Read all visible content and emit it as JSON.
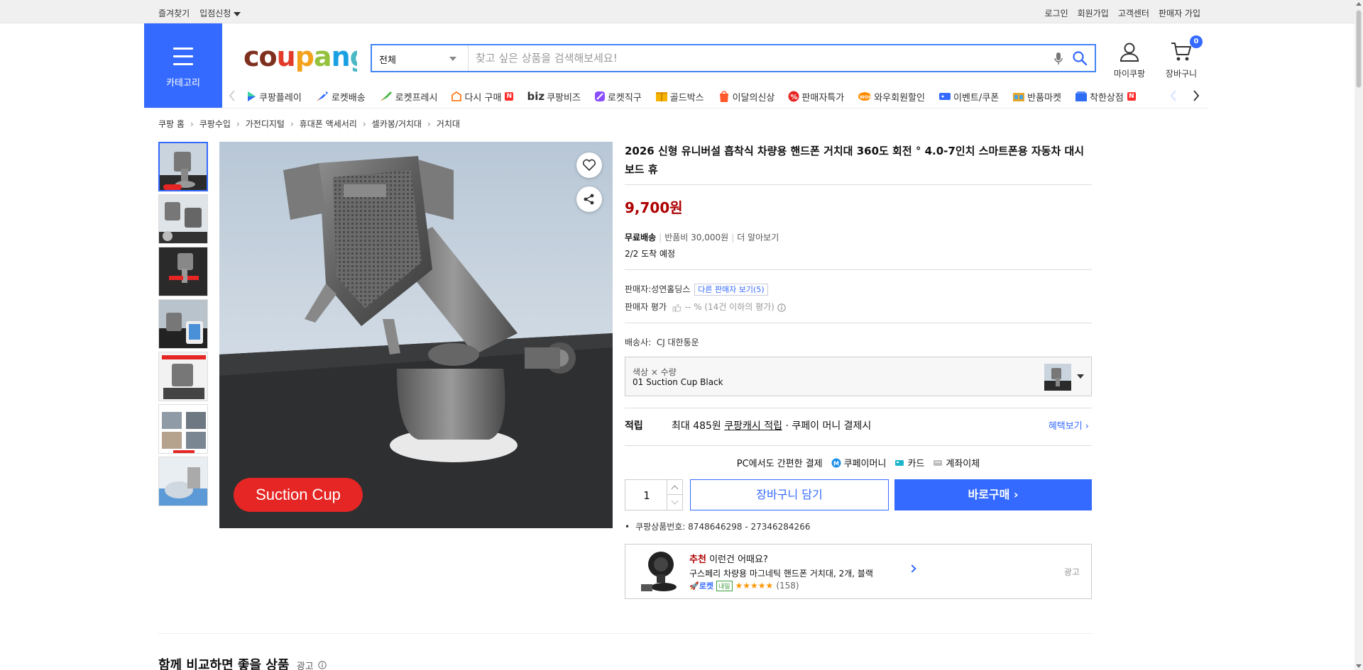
{
  "topbar": {
    "left": [
      "즐겨찾기",
      "입점신청"
    ],
    "right": [
      "로그인",
      "회원가입",
      "고객센터",
      "판매자 가입"
    ]
  },
  "header": {
    "category_label": "카테고리",
    "logo": {
      "text": "coupang"
    },
    "search": {
      "category": "전체",
      "placeholder": "찾고 싶은 상품을 검색해보세요!"
    },
    "mycoupang": "마이쿠팡",
    "cart": "장바구니",
    "cart_count": "0"
  },
  "subnav": {
    "items": [
      {
        "label": "쿠팡플레이",
        "icon": "play-icon"
      },
      {
        "label": "로켓배송",
        "icon": "rocket-icon"
      },
      {
        "label": "로켓프레시",
        "icon": "rocket-fresh-icon"
      },
      {
        "label": "다시 구매",
        "icon": "rebuy-icon",
        "badge": "N"
      },
      {
        "label": "쿠팡비즈",
        "prefix": "biz",
        "icon": "biz-icon"
      },
      {
        "label": "로켓직구",
        "icon": "global-icon"
      },
      {
        "label": "골드박스",
        "icon": "goldbox-icon"
      },
      {
        "label": "이달의신상",
        "icon": "new-icon"
      },
      {
        "label": "판매자특가",
        "icon": "percent-icon"
      },
      {
        "label": "와우회원할인",
        "icon": "wow-icon"
      },
      {
        "label": "이벤트/쿠폰",
        "icon": "coupon-icon"
      },
      {
        "label": "반품마켓",
        "icon": "return-market-icon"
      },
      {
        "label": "착한상점",
        "icon": "good-store-icon",
        "badge": "N"
      }
    ]
  },
  "breadcrumb": [
    "쿠팡 홈",
    "쿠팡수입",
    "가전디지털",
    "휴대폰 액세서리",
    "셀카봉/거치대",
    "거치대"
  ],
  "product": {
    "title": "2026 신형 유니버설 흡착식 차량용 핸드폰 거치대 360도 회전 ° 4.0-7인치 스마트폰용 자동차 대시보드 휴",
    "price": "9,700원",
    "image_caption": "Suction Cup",
    "shipping": {
      "free": "무료배송",
      "return_fee": "반품비 30,000원",
      "more": "더 알아보기",
      "arrival": "2/2 도착 예정"
    },
    "seller": {
      "label": "판매자:",
      "name": "성연홀딩스",
      "other": "다른 판매자 보기(5)"
    },
    "rating": {
      "label": "판매자 평가",
      "value": "-- % (14건 이하의 평가)"
    },
    "courier": {
      "label": "배송사:",
      "name": "CJ 대한통운"
    },
    "option": {
      "label": "색상 × 수량",
      "value": "01 Suction Cup Black"
    },
    "cash": {
      "label": "적립",
      "max": "최대 485원",
      "link": "쿠팡캐시 적립",
      "suffix": "· 쿠페이 머니 결제시",
      "more": "혜택보기"
    },
    "pay": {
      "label": "PC에서도 간편한 결제",
      "methods": [
        "쿠페이머니",
        "카드",
        "계좌이체"
      ]
    },
    "quantity": "1",
    "cart_button": "장바구니 담기",
    "buy_button": "바로구매",
    "code": "쿠팡상품번호: 8748646298 - 27346284266"
  },
  "recommend": {
    "tag": "추천",
    "title": "이런건 어때요?",
    "name": "구스페리 차량용 마그네틱 핸드폰 거치대, 2개, 블랙",
    "rocket": "로켓",
    "naeil": "내일",
    "stars": "★★★★★",
    "count": "(158)",
    "ad": "광고"
  },
  "compare": {
    "title": "함께 비교하면 좋을 상품",
    "ad": "광고"
  },
  "colors": {
    "brand_blue": "#346aff",
    "price_red": "#ae0000",
    "caption_red": "#e52624"
  }
}
